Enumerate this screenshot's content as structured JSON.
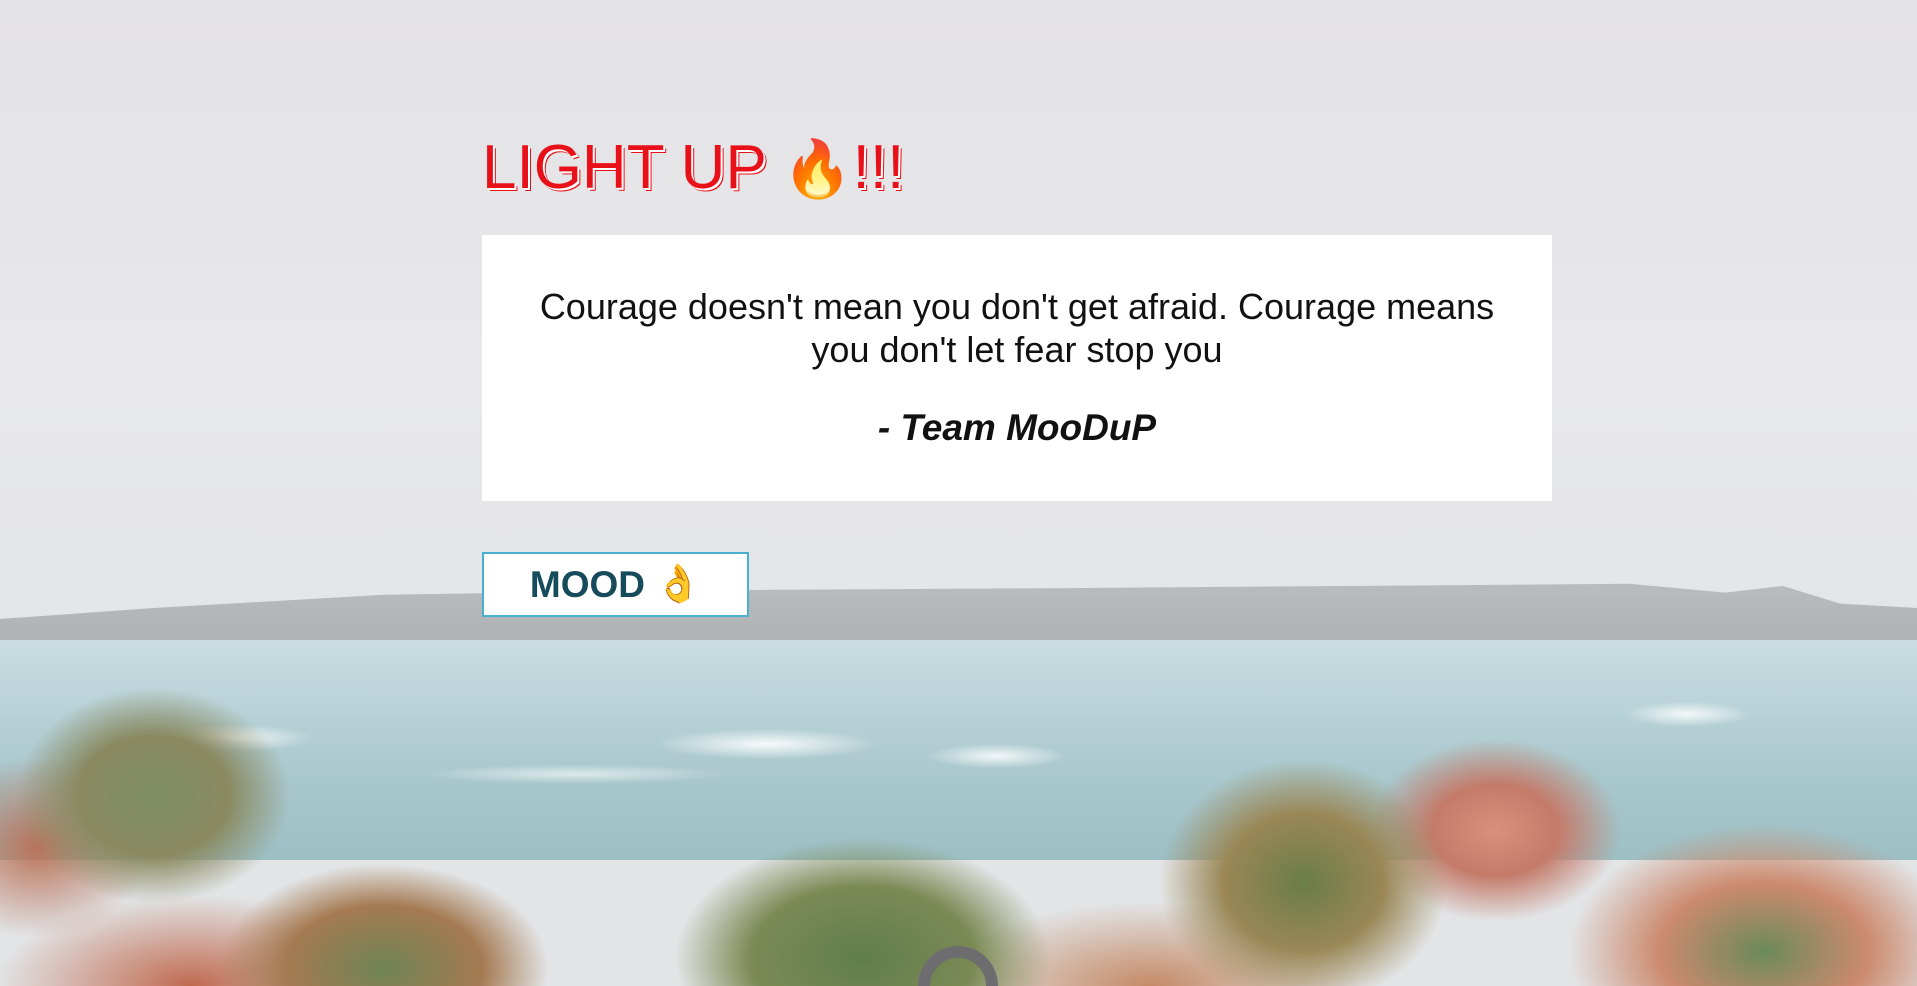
{
  "header": {
    "title_text": "LIGHT UP ",
    "title_emoji": "🔥",
    "title_suffix": "!!!"
  },
  "quote": {
    "text": "Courage doesn't mean you don't get afraid. Courage means you don't let fear stop you",
    "author": "- Team MooDuP"
  },
  "mood_button": {
    "label": "MOOD",
    "emoji": "👌"
  },
  "icons": {
    "fire": "fire-icon",
    "ok_hand": "ok-hand-icon",
    "loader": "loading-spinner-icon"
  },
  "colors": {
    "title": "#e8111a",
    "button_border": "#49b0cf",
    "button_text": "#164b5c",
    "card_background": "#ffffff"
  }
}
